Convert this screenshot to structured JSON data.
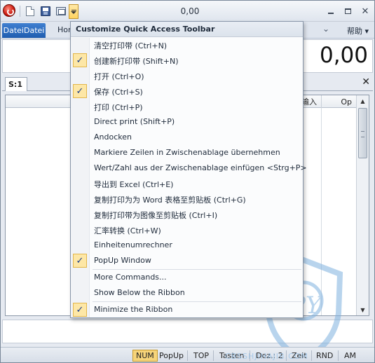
{
  "window": {
    "title": "0,00"
  },
  "qat": {
    "icons": [
      "app-orb-icon",
      "new-icon",
      "save-icon",
      "print-preview-icon",
      "customize-dropdown-icon"
    ]
  },
  "ribbon": {
    "file_tab": "DateiDatei",
    "tabs": [
      "Hor"
    ],
    "help": "帮助 ▾"
  },
  "display": {
    "value": "0,00"
  },
  "doc_tabs": {
    "active": "S:1",
    "close": "✕"
  },
  "grid": {
    "columns": [
      "输入",
      "Op"
    ]
  },
  "menu": {
    "title": "Customize Quick Access Toolbar",
    "items": [
      {
        "label": "清空打印带 (Ctrl+N)",
        "checked": false
      },
      {
        "label": "创建新打印带 (Shift+N)",
        "checked": true
      },
      {
        "label": "打开 (Ctrl+O)",
        "checked": false
      },
      {
        "label": "保存 (Ctrl+S)",
        "checked": true
      },
      {
        "label": "打印 (Ctrl+P)",
        "checked": false
      },
      {
        "label": "Direct print (Shift+P)",
        "checked": false
      },
      {
        "label": "Andocken",
        "checked": false
      },
      {
        "label": "Markiere Zeilen in Zwischenablage übernehmen",
        "checked": false
      },
      {
        "label": "Wert/Zahl aus der Zwischenablage einfügen <Strg+P>",
        "checked": false
      },
      {
        "label": "导出到 Excel (Ctrl+E)",
        "checked": false
      },
      {
        "label": "复制打印为为 Word 表格至剪贴板 (Ctrl+G)",
        "checked": false
      },
      {
        "label": "复制打印带为图像至剪贴板 (Ctrl+I)",
        "checked": false
      },
      {
        "label": "汇率转换 (Ctrl+W)",
        "checked": false
      },
      {
        "label": "Einheitenumrechner",
        "checked": false
      },
      {
        "label": "PopUp Window",
        "checked": true
      }
    ],
    "more_commands": "More Commands...",
    "show_below": "Show Below the Ribbon",
    "minimize": "Minimize the Ribbon",
    "minimize_checked": true,
    "check_glyph": "✓"
  },
  "status": {
    "items": [
      {
        "label": "NUM",
        "active": true
      },
      {
        "label": "PopUp",
        "active": false
      },
      {
        "label": "TOP",
        "active": false
      },
      {
        "label": "Tasten",
        "active": false
      },
      {
        "label": "Dez.: 2",
        "active": false
      },
      {
        "label": "Zeit",
        "active": false
      },
      {
        "label": "RND",
        "active": false
      },
      {
        "label": "AM",
        "active": false
      }
    ]
  },
  "watermark": {
    "text": "CBSSHJIHAJIB.COM",
    "letters": "PY",
    "color": "#7fb2e0"
  }
}
